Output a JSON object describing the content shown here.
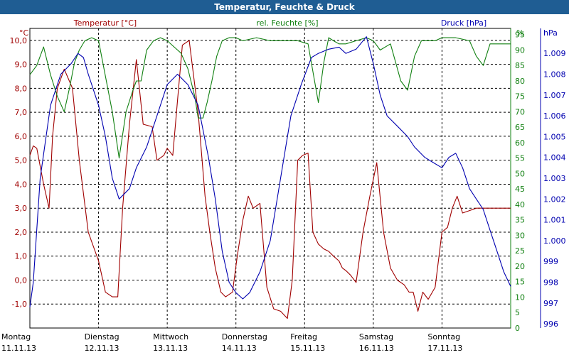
{
  "title": "Temperatur, Feuchte & Druck",
  "colors": {
    "titlebar": "#1f5d93",
    "temperature": "#a00000",
    "humidity": "#118011",
    "pressure": "#0000b0",
    "grid": "#000000"
  },
  "chart_data": {
    "type": "line",
    "title": "Temperatur, Feuchte & Druck",
    "grid": true,
    "x_range": [
      "11.11.13 00:00",
      "18.11.13 00:00"
    ],
    "x_ticks": [
      {
        "day": "Montag",
        "date": "11.11.13"
      },
      {
        "day": "Dienstag",
        "date": "12.11.13"
      },
      {
        "day": "Mittwoch",
        "date": "13.11.13"
      },
      {
        "day": "Donnerstag",
        "date": "14.11.13"
      },
      {
        "day": "Freitag",
        "date": "15.11.13"
      },
      {
        "day": "Samstag",
        "date": "16.11.13"
      },
      {
        "day": "Sonntag",
        "date": "17.11.13"
      }
    ],
    "axes": {
      "left": {
        "unit": "°C",
        "label": "Temperatur [°C]",
        "range": [
          -2,
          10.5
        ],
        "ticks": [
          "-1,0",
          "0,0",
          "1,0",
          "2,0",
          "3,0",
          "4,0",
          "5,0",
          "6,0",
          "7,0",
          "8,0",
          "9,0",
          "10,0"
        ]
      },
      "mid": {
        "unit": "%",
        "label": "rel. Feuchte [%]",
        "range": [
          0,
          97
        ],
        "ticks": [
          "0",
          "5",
          "10",
          "15",
          "20",
          "25",
          "30",
          "35",
          "40",
          "45",
          "50",
          "55",
          "60",
          "65",
          "70",
          "75",
          "80",
          "85",
          "90",
          "95"
        ]
      },
      "right": {
        "unit": "hPa",
        "label": "Druck [hPa]",
        "range": [
          995.8,
          1010.2
        ],
        "ticks": [
          "996",
          "997",
          "998",
          "999",
          "1.000",
          "1.001",
          "1.002",
          "1.003",
          "1.004",
          "1.005",
          "1.006",
          "1.007",
          "1.008",
          "1.009"
        ]
      }
    },
    "series": [
      {
        "name": "Temperatur [°C]",
        "axis": "left",
        "x": [
          0,
          0.05,
          0.1,
          0.2,
          0.28,
          0.33,
          0.4,
          0.5,
          0.62,
          0.72,
          0.85,
          1.0,
          1.1,
          1.2,
          1.28,
          1.35,
          1.45,
          1.55,
          1.65,
          1.78,
          1.85,
          1.95,
          2.0,
          2.08,
          2.15,
          2.22,
          2.32,
          2.45,
          2.55,
          2.62,
          2.7,
          2.78,
          2.85,
          2.95,
          3.02,
          3.1,
          3.18,
          3.25,
          3.35,
          3.45,
          3.55,
          3.65,
          3.75,
          3.82,
          3.9,
          3.97,
          4.05,
          4.12,
          4.2,
          4.28,
          4.35,
          4.42,
          4.5,
          4.55,
          4.6,
          4.67,
          4.75,
          4.85,
          4.95,
          5.05,
          5.15,
          5.25,
          5.35,
          5.45,
          5.52,
          5.58,
          5.65,
          5.72,
          5.8,
          5.9,
          6.0,
          6.08,
          6.15,
          6.22,
          6.3,
          6.4,
          6.5,
          6.6,
          6.7,
          6.8,
          6.9,
          7.0
        ],
        "values": [
          5.2,
          5.6,
          5.5,
          4.0,
          3.0,
          6.0,
          8.0,
          8.8,
          8.0,
          5.0,
          2.0,
          0.8,
          -0.5,
          -0.7,
          -0.7,
          3.0,
          6.5,
          9.2,
          6.5,
          6.4,
          5.0,
          5.2,
          5.5,
          5.2,
          7.5,
          9.8,
          10.0,
          7.0,
          3.5,
          2.0,
          0.5,
          -0.5,
          -0.7,
          -0.5,
          1.0,
          2.5,
          3.5,
          3.0,
          3.2,
          -0.3,
          -1.2,
          -1.3,
          -1.6,
          0.0,
          5.0,
          5.2,
          5.3,
          2.0,
          1.5,
          1.3,
          1.2,
          1.0,
          0.8,
          0.5,
          0.4,
          0.2,
          -0.1,
          2.0,
          3.5,
          4.9,
          2.0,
          0.5,
          0.0,
          -0.2,
          -0.5,
          -0.5,
          -1.3,
          -0.5,
          -0.8,
          -0.3,
          2.0,
          2.2,
          3.0,
          3.5,
          2.8,
          2.9,
          3.0,
          3.0,
          3.0,
          3.0,
          3.0,
          3.0
        ]
      },
      {
        "name": "rel. Feuchte [%]",
        "axis": "mid",
        "x": [
          0,
          0.1,
          0.2,
          0.3,
          0.4,
          0.5,
          0.58,
          0.65,
          0.72,
          0.8,
          0.9,
          1.0,
          1.2,
          1.3,
          1.4,
          1.5,
          1.55,
          1.62,
          1.7,
          1.8,
          1.9,
          2.0,
          2.1,
          2.2,
          2.3,
          2.4,
          2.45,
          2.52,
          2.58,
          2.65,
          2.72,
          2.8,
          2.9,
          3.0,
          3.1,
          3.3,
          3.5,
          3.7,
          3.9,
          4.05,
          4.2,
          4.28,
          4.35,
          4.42,
          4.5,
          4.6,
          4.75,
          4.9,
          5.0,
          5.1,
          5.25,
          5.4,
          5.5,
          5.6,
          5.7,
          5.8,
          5.9,
          6.0,
          6.2,
          6.4,
          6.5,
          6.6,
          6.7,
          6.8,
          6.9,
          7.0
        ],
        "values": [
          82,
          85,
          91,
          82,
          75,
          70,
          78,
          86,
          90,
          93,
          94,
          93,
          70,
          55,
          70,
          77,
          80,
          80,
          90,
          93,
          94,
          93,
          91,
          89,
          84,
          75,
          68,
          68,
          73,
          80,
          88,
          93,
          94,
          94,
          93,
          94,
          93,
          93,
          93,
          92,
          73,
          86,
          94,
          93,
          92,
          92,
          93,
          94,
          93,
          90,
          92,
          80,
          77,
          88,
          93,
          93,
          93,
          94,
          94,
          93,
          88,
          85,
          92,
          92,
          92,
          92
        ]
      },
      {
        "name": "Druck [hPa]",
        "axis": "right",
        "x": [
          0,
          0.05,
          0.15,
          0.3,
          0.45,
          0.6,
          0.7,
          0.78,
          0.85,
          1.0,
          1.1,
          1.2,
          1.3,
          1.45,
          1.55,
          1.7,
          1.85,
          2.0,
          2.15,
          2.3,
          2.45,
          2.6,
          2.7,
          2.8,
          2.9,
          3.0,
          3.1,
          3.2,
          3.35,
          3.5,
          3.6,
          3.7,
          3.8,
          3.95,
          4.1,
          4.2,
          4.35,
          4.5,
          4.6,
          4.75,
          4.9,
          5.0,
          5.1,
          5.2,
          5.35,
          5.5,
          5.6,
          5.75,
          5.85,
          6.0,
          6.1,
          6.2,
          6.3,
          6.4,
          6.5,
          6.6,
          6.7,
          6.8,
          6.9,
          7.0
        ],
        "values": [
          996.8,
          998.0,
          1003.0,
          1006.5,
          1008.0,
          1008.5,
          1009.0,
          1008.8,
          1008.0,
          1006.5,
          1005.0,
          1003.0,
          1002.0,
          1002.5,
          1003.5,
          1004.5,
          1006.0,
          1007.5,
          1008.0,
          1007.5,
          1006.5,
          1004.0,
          1002.0,
          999.5,
          998.0,
          997.5,
          997.2,
          997.5,
          998.5,
          1000.0,
          1002.0,
          1004.0,
          1006.0,
          1007.5,
          1008.8,
          1009.0,
          1009.2,
          1009.3,
          1009.0,
          1009.2,
          1009.8,
          1008.5,
          1007.0,
          1006.0,
          1005.5,
          1005.0,
          1004.5,
          1004.0,
          1003.8,
          1003.5,
          1004.0,
          1004.2,
          1003.5,
          1002.5,
          1002.0,
          1001.5,
          1000.5,
          999.5,
          998.5,
          997.8
        ]
      }
    ]
  }
}
